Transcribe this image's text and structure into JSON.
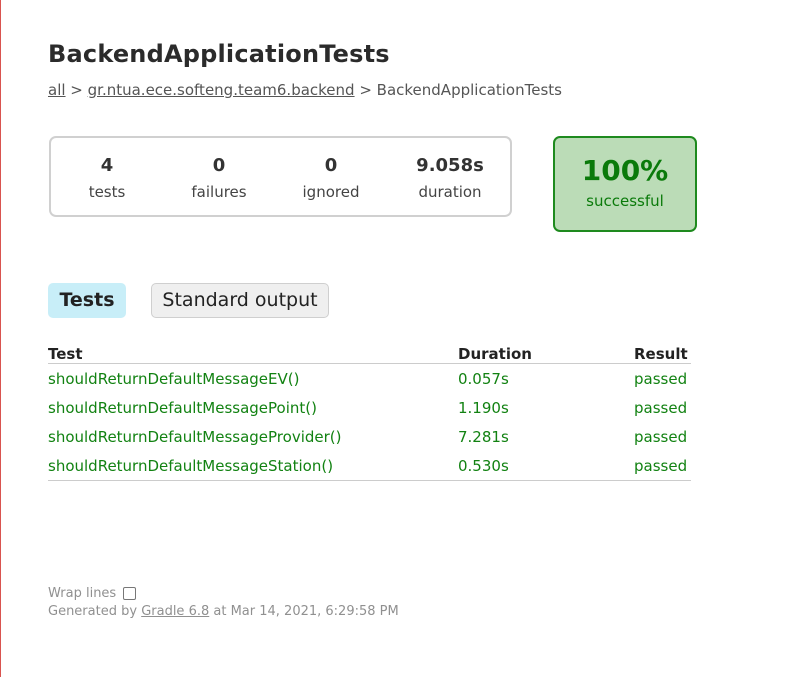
{
  "page": {
    "title": "BackendApplicationTests",
    "breadcrumb": {
      "all": "all",
      "sep1": " > ",
      "package": "gr.ntua.ece.softeng.team6.backend",
      "sep2": " > ",
      "current": "BackendApplicationTests"
    }
  },
  "summary": {
    "tests": {
      "value": "4",
      "label": "tests"
    },
    "failures": {
      "value": "0",
      "label": "failures"
    },
    "ignored": {
      "value": "0",
      "label": "ignored"
    },
    "duration": {
      "value": "9.058s",
      "label": "duration"
    },
    "success": {
      "value": "100%",
      "label": "successful"
    }
  },
  "tabs": [
    {
      "label": "Tests",
      "selected": true
    },
    {
      "label": "Standard output",
      "selected": false
    }
  ],
  "table": {
    "headers": [
      "Test",
      "Duration",
      "Result"
    ],
    "rows": [
      [
        "shouldReturnDefaultMessageEV()",
        "0.057s",
        "passed"
      ],
      [
        "shouldReturnDefaultMessagePoint()",
        "1.190s",
        "passed"
      ],
      [
        "shouldReturnDefaultMessageProvider()",
        "7.281s",
        "passed"
      ],
      [
        "shouldReturnDefaultMessageStation()",
        "0.530s",
        "passed"
      ]
    ]
  },
  "footer": {
    "wrap_label": "Wrap lines",
    "generated_prefix": "Generated by ",
    "gradle_link": "Gradle 6.8",
    "generated_suffix": " at Mar 14, 2021, 6:29:58 PM"
  },
  "colors": {
    "success_green": "#128212",
    "success_box_bg": "#bbdcb7",
    "tab_selected_bg": "#c8eef8"
  }
}
